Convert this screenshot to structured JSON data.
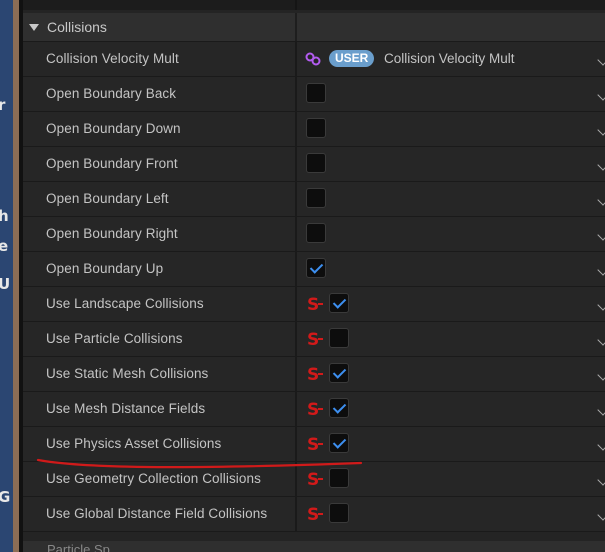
{
  "left_strip_glyphs": [
    "r",
    "h",
    "e",
    "U",
    "G"
  ],
  "section": {
    "title": "Collisions"
  },
  "rows": [
    {
      "label": "Collision Velocity Mult",
      "kind": "user",
      "badge": "USER",
      "value_text": "Collision Velocity Mult",
      "icon": "link-icon"
    },
    {
      "label": "Open Boundary Back",
      "kind": "checkbox",
      "checked": false
    },
    {
      "label": "Open Boundary Down",
      "kind": "checkbox",
      "checked": false
    },
    {
      "label": "Open Boundary Front",
      "kind": "checkbox",
      "checked": false
    },
    {
      "label": "Open Boundary Left",
      "kind": "checkbox",
      "checked": false
    },
    {
      "label": "Open Boundary Right",
      "kind": "checkbox",
      "checked": false
    },
    {
      "label": "Open Boundary Up",
      "kind": "checkbox",
      "checked": true
    },
    {
      "label": "Use Landscape Collisions",
      "kind": "s-checkbox",
      "checked": true,
      "icon": "static-switch-icon"
    },
    {
      "label": "Use Particle Collisions",
      "kind": "s-checkbox",
      "checked": false,
      "icon": "static-switch-icon"
    },
    {
      "label": "Use Static Mesh Collisions",
      "kind": "s-checkbox",
      "checked": true,
      "icon": "static-switch-icon"
    },
    {
      "label": "Use Mesh Distance Fields",
      "kind": "s-checkbox",
      "checked": true,
      "icon": "static-switch-icon"
    },
    {
      "label": "Use Physics Asset Collisions",
      "kind": "s-checkbox",
      "checked": true,
      "icon": "static-switch-icon",
      "underlined": true
    },
    {
      "label": "Use Geometry Collection Collisions",
      "kind": "s-checkbox",
      "checked": false,
      "icon": "static-switch-icon"
    },
    {
      "label": "Use Global Distance Field Collisions",
      "kind": "s-checkbox",
      "checked": false,
      "icon": "static-switch-icon"
    }
  ],
  "next_section": {
    "title": "Particle Sp..."
  },
  "colors": {
    "accent_check": "#3d8ff0",
    "user_badge": "#6a9ecc",
    "switch_icon": "#d21a1a",
    "link_icon": "#b35cf0",
    "annotation": "#d01a1a"
  }
}
